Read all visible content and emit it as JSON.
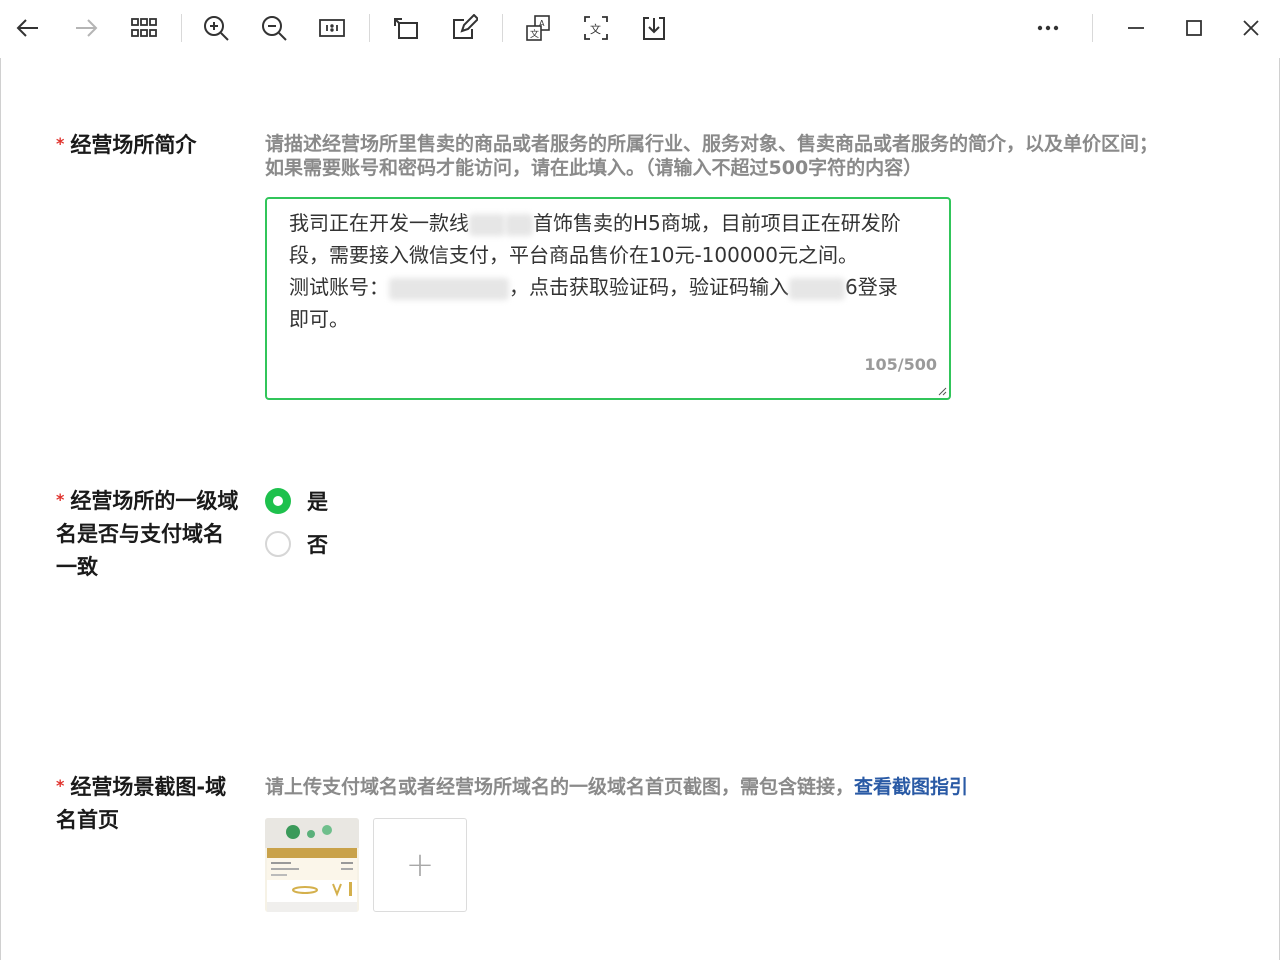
{
  "toolbar": {
    "icons": [
      "back-arrow-icon",
      "forward-arrow-icon",
      "grid-icon",
      "zoom-in-icon",
      "zoom-out-icon",
      "actual-size-icon",
      "rotate-icon",
      "edit-icon",
      "translate-icon",
      "ocr-text-icon",
      "download-icon",
      "more-icon",
      "minimize-icon",
      "maximize-icon",
      "close-icon"
    ]
  },
  "form": {
    "required_mark": "*",
    "venue_intro": {
      "label": "经营场所简介",
      "hint_line1": "请描述经营场所里售卖的商品或者服务的所属行业、服务对象、售卖商品或者服务的简介，以及单价区间；",
      "hint_line2": "如果需要账号和密码才能访问，请在此填入。（请输入不超过500字符的内容）",
      "text_line1a": "我司正在开发一款线",
      "text_line1b": "首饰售卖的H5商城，目前项目正在研发阶",
      "text_line2": "段，需要接入微信支付，平台商品售价在10元-100000元之间。",
      "text_line3a": "测试账号：",
      "text_line3b": "，点击获取验证码，验证码输入",
      "text_line3c": "6登录",
      "text_line4": "即可。",
      "counter": "105/500"
    },
    "domain_match": {
      "label_line1": "经营场所的一级域",
      "label_line2": "名是否与支付域名",
      "label_line3": "一致",
      "options": [
        {
          "label": "是",
          "selected": true
        },
        {
          "label": "否",
          "selected": false
        }
      ]
    },
    "screenshot": {
      "label_line1": "经营场景截图-域",
      "label_line2": "名首页",
      "hint": "请上传支付域名或者经营场所域名的一级域名首页截图，需包含链接，",
      "hint_link": "查看截图指引",
      "upload_plus": "+"
    }
  },
  "colors": {
    "accent_green": "#1ec14d",
    "required_red": "#e0322c",
    "link_blue": "#2a5aa5"
  }
}
